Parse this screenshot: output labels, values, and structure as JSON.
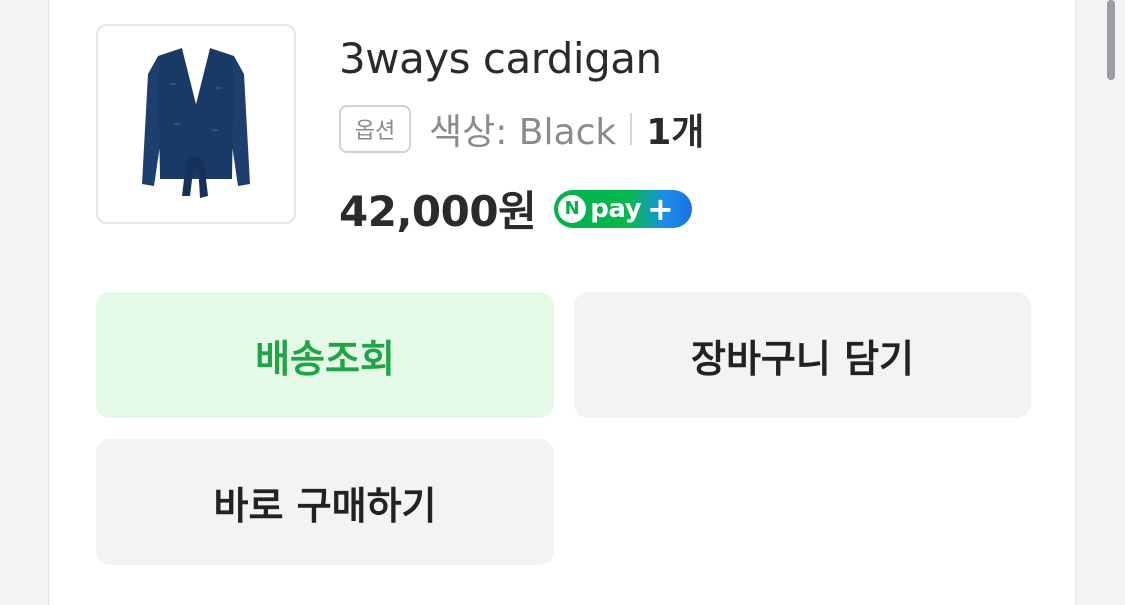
{
  "product": {
    "name": "3ways cardigan",
    "option_badge": "옵션",
    "option_value": "색상: Black",
    "quantity": "1개",
    "price": "42,000원",
    "product_color": "#1c3f6e"
  },
  "npay": {
    "n_letter": "N",
    "label": "pay",
    "plus": "+",
    "colors": {
      "green": "#04b14a",
      "blue": "#1d6fe2"
    }
  },
  "actions": {
    "track_delivery": "배송조회",
    "add_to_cart": "장바구니 담기",
    "buy_now": "바로 구매하기"
  },
  "accent_colors": {
    "track_bg": "#e4f9e6",
    "track_text": "#1fa447",
    "neutral_bg": "#f2f3f5"
  }
}
